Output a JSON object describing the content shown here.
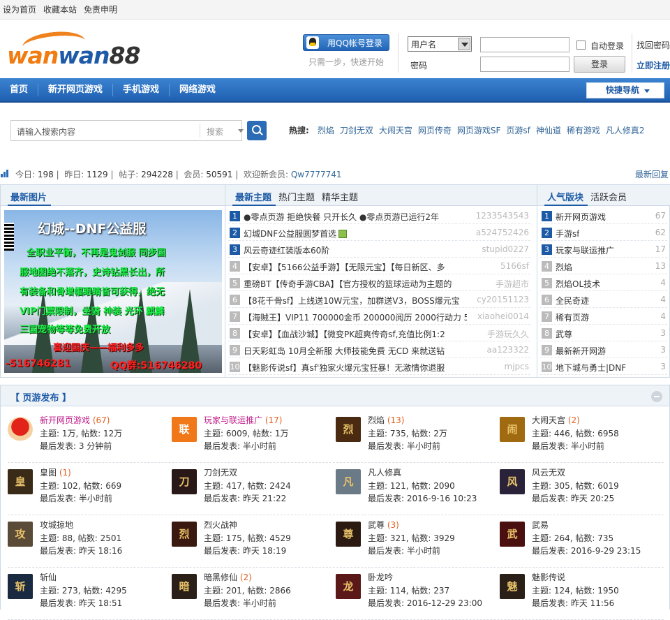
{
  "topbar": {
    "links": [
      "设为首页",
      "收藏本站",
      "免责申明"
    ]
  },
  "logo": {
    "part1": "wan",
    "part2": "wan",
    "part3": "88"
  },
  "login": {
    "qq_button": "用QQ帐号登录",
    "qq_sub": "只需一步，快速开始",
    "username_select": "用户名",
    "password_label": "密码",
    "auto_login": "自动登录",
    "login_button": "登录",
    "forgot": "找回密码",
    "register": "立即注册"
  },
  "nav": {
    "items": [
      "首页",
      "新开网页游戏",
      "手机游戏",
      "网络游戏"
    ],
    "quick": "快捷导航"
  },
  "search": {
    "placeholder": "请输入搜索内容",
    "type": "搜索",
    "hot_label": "热搜:",
    "hot": [
      "烈焰",
      "刀剑无双",
      "大闹天宫",
      "网页传奇",
      "网页游戏SF",
      "页游sf",
      "神仙道",
      "稀有游戏",
      "凡人修真2"
    ]
  },
  "stats": {
    "today_label": "今日:",
    "today": "198",
    "yesterday_label": "昨日:",
    "yesterday": "1129",
    "posts_label": "帖子:",
    "posts": "294228",
    "members_label": "会员:",
    "members": "50591",
    "welcome": "欢迎新会员:",
    "new_member": "Qw7777741",
    "latest_reply": "最新回复"
  },
  "col_pics": {
    "title": "最新图片",
    "image_text": {
      "title": "幻城--DNF公益服",
      "lines": [
        "全职业平衡，不再是鬼剑服 同步国",
        "服地图绝不落齐，史诗钻黑长出，所",
        "有装备和骨增幅眼睛皆可获得，绝无",
        "VIP门票限制，坐骑 神装 光环 麒麟",
        "三国宠物等等免费开放",
        "喜迎国庆——福利多多"
      ],
      "phone": "-516746281",
      "qq": "QQ群:516746280"
    }
  },
  "col_topics": {
    "tabs": [
      "最新主题",
      "热门主题",
      "精华主题"
    ],
    "rows": [
      {
        "n": "1",
        "title": "●零点页游 拒绝快餐 只开长久 ●零点页游已运行2年",
        "author": "1233543543"
      },
      {
        "n": "2",
        "title": "幻城DNF公益服圆梦首选",
        "author": "a524752426",
        "img": true
      },
      {
        "n": "3",
        "title": "风云奇迹红装版本60阶",
        "author": "stupid0227"
      },
      {
        "n": "4",
        "title": "【安卓】【5166公益手游】【无限元宝】【每日新区、多",
        "author": "5166sf"
      },
      {
        "n": "5",
        "title": "重磅BT【传奇手游CBA】【官方授权的篮球运动为主题的",
        "author": "手游超市"
      },
      {
        "n": "6",
        "title": "【8花千骨sf】上线送10W元宝，加群送V3，BOSS爆元宝",
        "author": "cy20151123"
      },
      {
        "n": "7",
        "title": "【海贼王】VIP11 700000金币 200000阅历 2000行动力 5",
        "author": "xiaohei0014"
      },
      {
        "n": "8",
        "title": "【安卓】【血战沙城】【微变PK超爽传奇sf,充值比例1:2",
        "author": "手游玩久久"
      },
      {
        "n": "9",
        "title": "日天彩虹岛 10月全新服 大师技能免费 无CD 来就送钻",
        "author": "aa123322"
      },
      {
        "n": "10",
        "title": "【魅影传说sf】真sf'独家火爆元宝狂暴！无激情你退服",
        "author": "mjpcs"
      }
    ]
  },
  "col_boards": {
    "tabs": [
      "人气版块",
      "活跃会员"
    ],
    "rows": [
      {
        "n": "1",
        "name": "新开网页游戏",
        "count": "67"
      },
      {
        "n": "2",
        "name": "手游sf",
        "count": "62"
      },
      {
        "n": "3",
        "name": "玩家与联运推广",
        "count": "17"
      },
      {
        "n": "4",
        "name": "烈焰",
        "count": "13"
      },
      {
        "n": "5",
        "name": "烈焰OL技术",
        "count": "4"
      },
      {
        "n": "6",
        "name": "全民奇迹",
        "count": "4"
      },
      {
        "n": "7",
        "name": "稀有页游",
        "count": "4"
      },
      {
        "n": "8",
        "name": "武尊",
        "count": "3"
      },
      {
        "n": "9",
        "name": "最新新开网游",
        "count": "3"
      },
      {
        "n": "10",
        "name": "地下城与勇士|DNF",
        "count": "3"
      }
    ]
  },
  "forum": {
    "title": "【 页游发布 】",
    "rows": [
      [
        {
          "name": "新开网页游戏",
          "count": "(67)",
          "hl": true,
          "topics": "主题: 1万, 帖数: 12万",
          "last": "最后发表: 3 分钟前",
          "icon": "mario",
          "color": "#d3231e"
        },
        {
          "name": "玩家与联运推广",
          "count": "(17)",
          "hl": true,
          "topics": "主题: 6009, 帖数: 1万",
          "last": "最后发表: 半小时前",
          "icon": "联",
          "color": "#f07818"
        },
        {
          "name": "烈焰",
          "count": "(13)",
          "hl": false,
          "topics": "主题: 735, 帖数: 2万",
          "last": "最后发表: 半小时前",
          "icon": "烈",
          "color": "#4a2a10"
        },
        {
          "name": "大闹天宫",
          "count": "(2)",
          "hl": false,
          "topics": "主题: 446, 帖数: 6958",
          "last": "最后发表: 半小时前",
          "icon": "闹",
          "color": "#a06a10"
        }
      ],
      [
        {
          "name": "皇图",
          "count": "(1)",
          "hl": false,
          "topics": "主题: 102, 帖数: 669",
          "last": "最后发表: 半小时前",
          "icon": "皇",
          "color": "#3a2a18"
        },
        {
          "name": "刀剑无双",
          "count": "",
          "hl": false,
          "topics": "主题: 417, 帖数: 2424",
          "last": "最后发表: 昨天 21:22",
          "icon": "刀",
          "color": "#281818"
        },
        {
          "name": "凡人修真",
          "count": "",
          "hl": false,
          "topics": "主题: 121, 帖数: 2090",
          "last": "最后发表: 2016-9-16 10:23",
          "icon": "凡",
          "color": "#6a7a86"
        },
        {
          "name": "风云无双",
          "count": "",
          "hl": false,
          "topics": "主题: 305, 帖数: 6019",
          "last": "最后发表: 昨天 20:25",
          "icon": "风",
          "color": "#2a2238"
        }
      ],
      [
        {
          "name": "攻城掠地",
          "count": "",
          "hl": false,
          "topics": "主题: 88, 帖数: 2501",
          "last": "最后发表: 昨天 18:16",
          "icon": "攻",
          "color": "#5a4a38"
        },
        {
          "name": "烈火战神",
          "count": "",
          "hl": false,
          "topics": "主题: 175, 帖数: 4529",
          "last": "最后发表: 昨天 18:19",
          "icon": "烈",
          "color": "#3a1a10"
        },
        {
          "name": "武尊",
          "count": "(3)",
          "hl": false,
          "topics": "主题: 321, 帖数: 3929",
          "last": "最后发表: 半小时前",
          "icon": "尊",
          "color": "#2a1a12"
        },
        {
          "name": "武易",
          "count": "",
          "hl": false,
          "topics": "主题: 264, 帖数: 735",
          "last": "最后发表: 2016-9-29 23:15",
          "icon": "武",
          "color": "#4a1010"
        }
      ],
      [
        {
          "name": "斩仙",
          "count": "",
          "hl": false,
          "topics": "主题: 273, 帖数: 4295",
          "last": "最后发表: 昨天 18:51",
          "icon": "斩",
          "color": "#1a2a40"
        },
        {
          "name": "暗黑修仙",
          "count": "(2)",
          "hl": false,
          "topics": "主题: 201, 帖数: 2866",
          "last": "最后发表: 半小时前",
          "icon": "暗",
          "color": "#2a2018"
        },
        {
          "name": "卧龙吟",
          "count": "",
          "hl": false,
          "topics": "主题: 114, 帖数: 237",
          "last": "最后发表: 2016-12-29 23:00",
          "icon": "龙",
          "color": "#5a1818"
        },
        {
          "name": "魅影传说",
          "count": "",
          "hl": false,
          "topics": "主题: 124, 帖数: 1950",
          "last": "最后发表: 昨天 11:56",
          "icon": "魅",
          "color": "#2a2018"
        }
      ]
    ]
  }
}
